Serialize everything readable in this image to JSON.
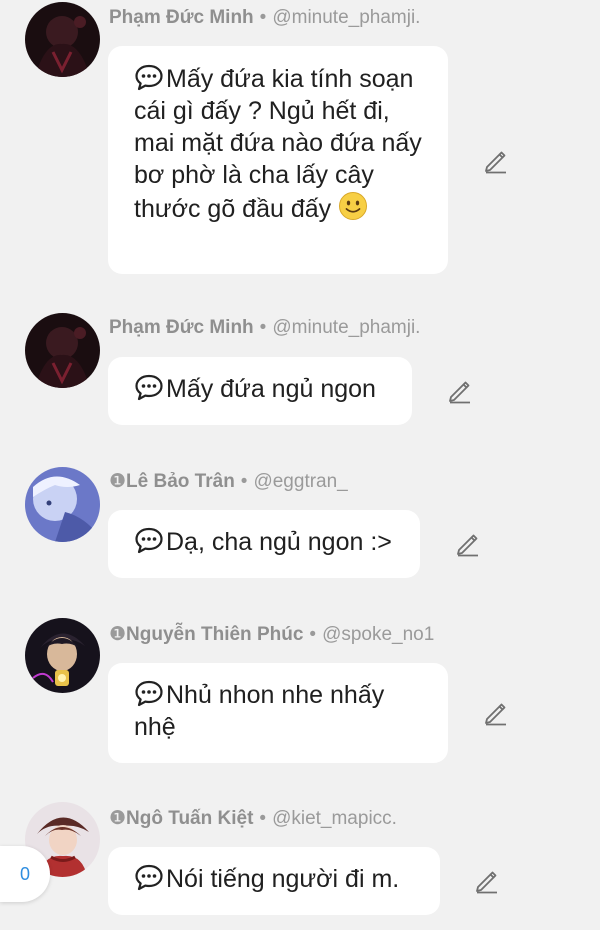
{
  "messages": [
    {
      "prefix": "",
      "name": "Phạm Đức Minh",
      "handle": "@minute_phamji.",
      "text": "Mấy đứa kia tính soạn cái gì đấy ? Ngủ hết đi, mai mặt đứa nào đứa nấy bơ phờ là cha lấy cây thước gõ đầu đấy",
      "emoji": "slightly-smiling-face",
      "avatar": "dark-hooded-figure"
    },
    {
      "prefix": "",
      "name": "Phạm Đức Minh",
      "handle": "@minute_phamji.",
      "text": "Mấy đứa ngủ ngon",
      "avatar": "dark-hooded-figure"
    },
    {
      "prefix": "❶",
      "name": "Lê Bảo Trân",
      "handle": "@eggtran_",
      "text": "Dạ, cha ngủ ngon :>",
      "avatar": "blue-haired-character"
    },
    {
      "prefix": "❶",
      "name": "Nguyễn Thiên Phúc",
      "handle": "@spoke_no1",
      "text": "Nhủ nhon nhe nhấy nhệ",
      "avatar": "character-with-lantern"
    },
    {
      "prefix": "❶",
      "name": "Ngô Tuấn Kiệt",
      "handle": "@kiet_mapicc.",
      "text": "Nói tiếng người đi m.",
      "avatar": "red-scarf-character"
    }
  ],
  "badge": {
    "count": "0"
  },
  "icons": {
    "chat": "speech-bubble-icon",
    "edit": "pencil-icon"
  },
  "colors": {
    "background": "#f1f1f1",
    "bubble": "#ffffff",
    "meta_text": "#9a9a9a",
    "badge_text": "#2f8ee0"
  }
}
